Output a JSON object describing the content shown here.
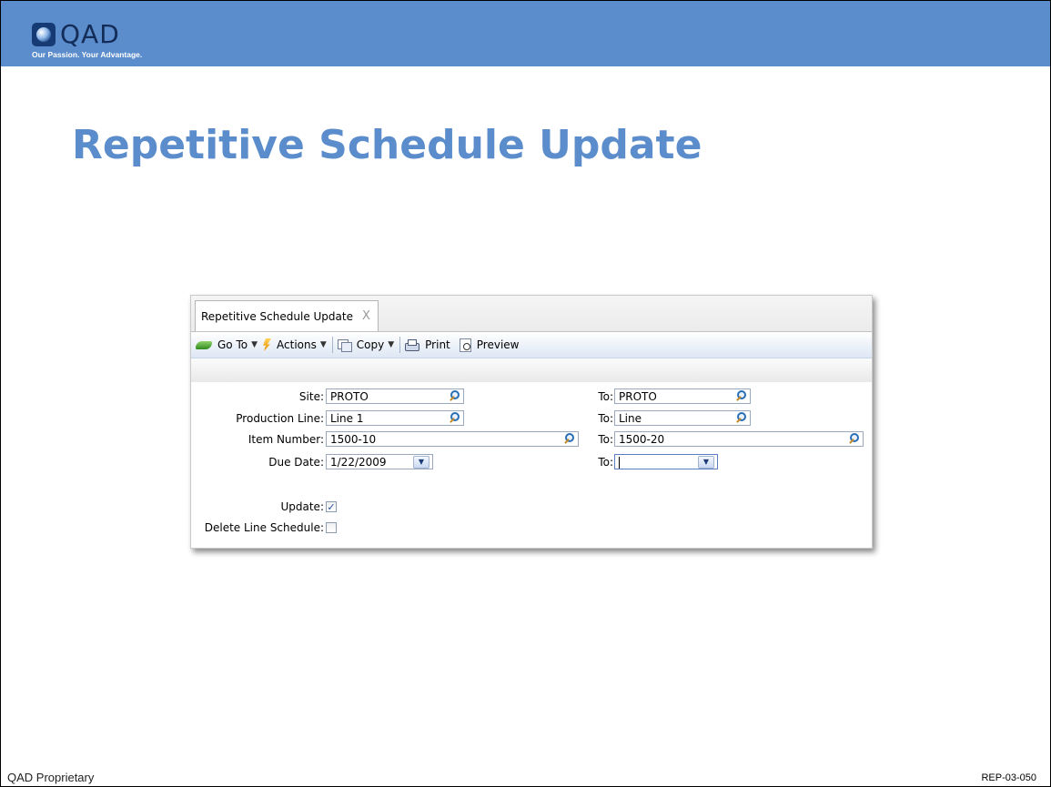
{
  "header": {
    "logo_text": "QAD",
    "tagline": "Our Passion. Your Advantage."
  },
  "slide": {
    "title": "Repetitive Schedule Update",
    "footer_left": "QAD Proprietary",
    "footer_right": "REP-03-050"
  },
  "window": {
    "tab_label": "Repetitive Schedule Update",
    "tab_close": "X",
    "toolbar": {
      "goto_label": "Go To",
      "actions_label": "Actions",
      "copy_label": "Copy",
      "print_label": "Print",
      "preview_label": "Preview"
    },
    "form": {
      "to_label": "To:",
      "site": {
        "label": "Site:",
        "from": "PROTO",
        "to": "PROTO"
      },
      "production_line": {
        "label": "Production Line:",
        "from": "Line 1",
        "to": "Line"
      },
      "item_number": {
        "label": "Item Number:",
        "from": "1500-10",
        "to": "1500-20"
      },
      "due_date": {
        "label": "Due Date:",
        "from": "1/22/2009",
        "to": ""
      },
      "update": {
        "label": "Update:",
        "checked": true,
        "mark": "✓"
      },
      "delete_line_schedule": {
        "label": "Delete Line Schedule:",
        "checked": false
      }
    }
  },
  "colors": {
    "header_bg": "#5b8ccb",
    "title": "#5b8ccb"
  }
}
